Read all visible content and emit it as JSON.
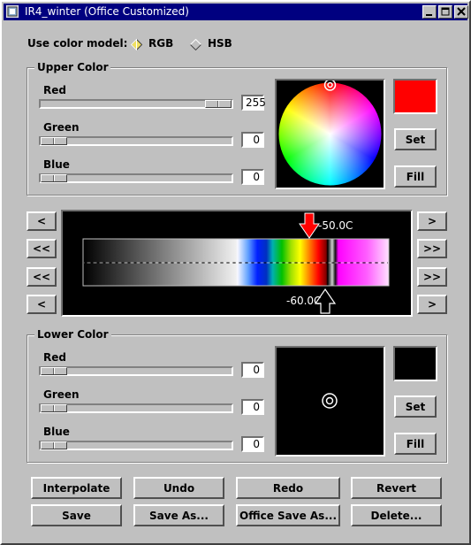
{
  "window": {
    "title": "IR4_winter (Office Customized)"
  },
  "color_model": {
    "label": "Use color model:",
    "options": [
      "RGB",
      "HSB"
    ],
    "selected": "RGB"
  },
  "upper": {
    "title": "Upper Color",
    "red": {
      "label": "Red",
      "value": "255",
      "level": 1.0
    },
    "green": {
      "label": "Green",
      "value": "0",
      "level": 0.0
    },
    "blue": {
      "label": "Blue",
      "value": "0",
      "level": 0.0
    },
    "swatch_color": "#ff0000",
    "set_label": "Set",
    "fill_label": "Fill"
  },
  "palette": {
    "upper_marker": "-50.0C",
    "lower_marker": "-60.0C",
    "nav_left": [
      "<",
      "<<",
      "<<",
      "<"
    ],
    "nav_right": [
      ">",
      ">>",
      ">>",
      ">"
    ]
  },
  "lower": {
    "title": "Lower Color",
    "red": {
      "label": "Red",
      "value": "0",
      "level": 0.0
    },
    "green": {
      "label": "Green",
      "value": "0",
      "level": 0.0
    },
    "blue": {
      "label": "Blue",
      "value": "0",
      "level": 0.0
    },
    "swatch_color": "#000000",
    "set_label": "Set",
    "fill_label": "Fill"
  },
  "actions": {
    "row1": [
      "Interpolate",
      "Undo",
      "Redo",
      "Revert"
    ],
    "row2": [
      "Save",
      "Save As...",
      "Office Save As...",
      "Delete..."
    ]
  }
}
